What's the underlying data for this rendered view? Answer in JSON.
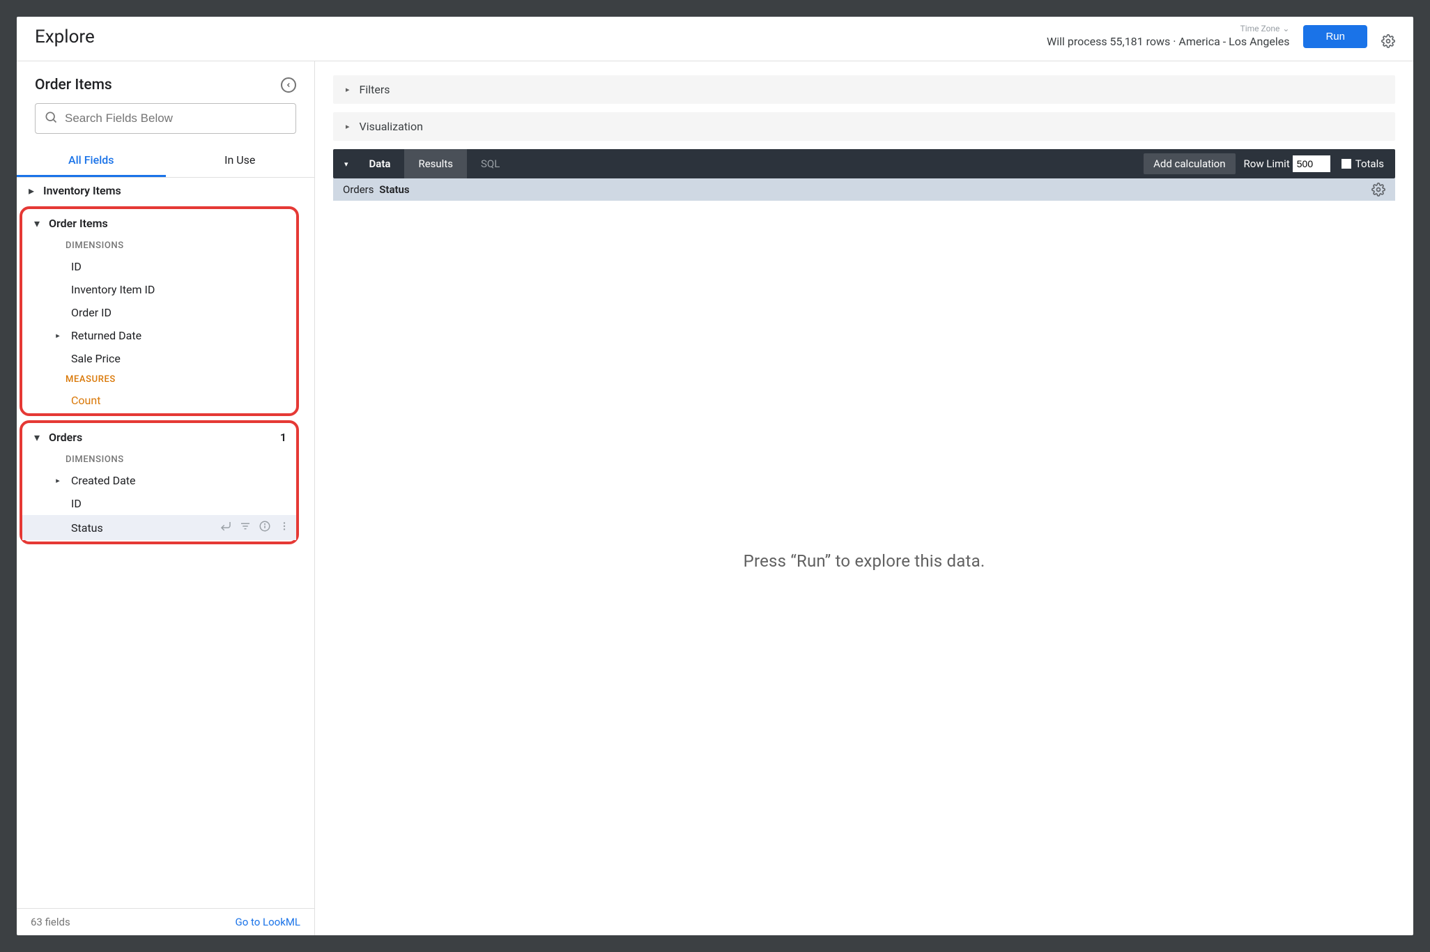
{
  "topbar": {
    "title": "Explore",
    "process_text": "Will process 55,181 rows · ",
    "timezone_label": "Time Zone",
    "timezone_value": "America - Los Angeles",
    "run_label": "Run"
  },
  "sidebar": {
    "explore_title": "Order Items",
    "search_placeholder": "Search Fields Below",
    "tabs": {
      "all": "All Fields",
      "inuse": "In Use"
    },
    "views": {
      "inventory_items": {
        "label": "Inventory Items"
      },
      "order_items": {
        "label": "Order Items",
        "dimensions_label": "DIMENSIONS",
        "dims": {
          "id": "ID",
          "inventory_item_id": "Inventory Item ID",
          "order_id": "Order ID",
          "returned_date": "Returned Date",
          "sale_price": "Sale Price"
        },
        "measures_label": "MEASURES",
        "measures": {
          "count": "Count"
        }
      },
      "orders": {
        "label": "Orders",
        "selected_count": "1",
        "dimensions_label": "DIMENSIONS",
        "dims": {
          "created_date": "Created Date",
          "id": "ID",
          "status": "Status"
        }
      }
    },
    "footer": {
      "count": "63 fields",
      "link": "Go to LookML"
    }
  },
  "main": {
    "panels": {
      "filters": "Filters",
      "visualization": "Visualization"
    },
    "databar": {
      "data": "Data",
      "results": "Results",
      "sql": "SQL",
      "add_calc": "Add calculation",
      "row_limit_label": "Row Limit",
      "row_limit_value": "500",
      "totals": "Totals"
    },
    "column_header": {
      "prefix": "Orders",
      "name": "Status"
    },
    "run_prompt": "Press “Run” to explore this data."
  }
}
